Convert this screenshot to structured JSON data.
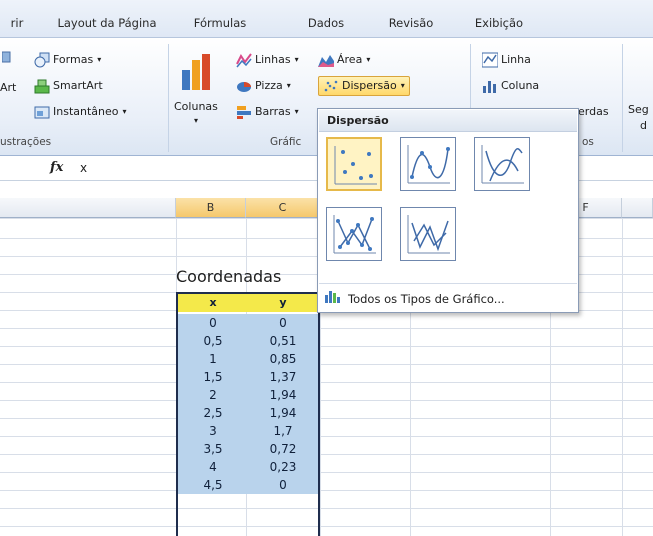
{
  "ribbon_tabs": [
    "rir",
    "Layout da Página",
    "Fórmulas",
    "Dados",
    "Revisão",
    "Exibição"
  ],
  "ribbon": {
    "illustrations": {
      "shapes": "Formas",
      "smartart": "SmartArt",
      "screenshot": "Instantâneo",
      "art_fragment": "Art",
      "group_label": "ustrações"
    },
    "charts": {
      "columns": "Colunas",
      "lines": "Linhas",
      "pie": "Pizza",
      "bars": "Barras",
      "area": "Área",
      "scatter": "Dispersão",
      "group_label": "Gráfic"
    },
    "sparklines": {
      "line": "Linha",
      "column": "Coluna",
      "partial_label": "erdas",
      "group_partial": "os"
    },
    "right_partial_1": "Seg",
    "right_partial_2": "d"
  },
  "formula_bar": {
    "fx": "fx",
    "value": "x"
  },
  "columns": {
    "b": "B",
    "c": "C",
    "f": "F"
  },
  "table": {
    "title": "Coordenadas",
    "headers": [
      "x",
      "y"
    ],
    "rows": [
      [
        "0",
        "0"
      ],
      [
        "0,5",
        "0,51"
      ],
      [
        "1",
        "0,85"
      ],
      [
        "1,5",
        "1,37"
      ],
      [
        "2",
        "1,94"
      ],
      [
        "2,5",
        "1,94"
      ],
      [
        "3",
        "1,7"
      ],
      [
        "3,5",
        "0,72"
      ],
      [
        "4",
        "0,23"
      ],
      [
        "4,5",
        "0"
      ]
    ]
  },
  "dropdown": {
    "header": "Dispersão",
    "thumbnails": [
      "scatter-markers-only",
      "scatter-smooth-lines-markers",
      "scatter-smooth-lines",
      "scatter-straight-lines-markers",
      "scatter-straight-lines"
    ],
    "all_types": "Todos os Tipos de Gráfico..."
  },
  "colors": {
    "header_yellow": "#f4e94a",
    "cell_blue": "#b9d3ec",
    "selected_column": "#f5c86c",
    "accent_border": "#1f2d4d"
  }
}
